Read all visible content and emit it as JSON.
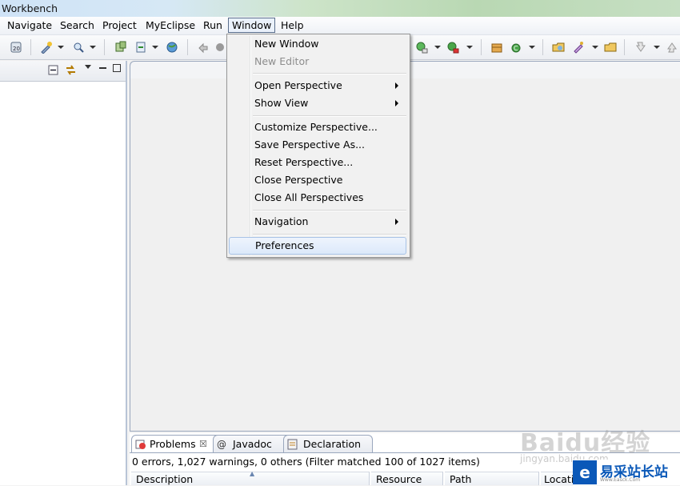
{
  "window": {
    "title": "Workbench"
  },
  "menubar": {
    "items": [
      {
        "label": "Navigate"
      },
      {
        "label": "Search"
      },
      {
        "label": "Project"
      },
      {
        "label": "MyEclipse"
      },
      {
        "label": "Run"
      },
      {
        "label": "Window"
      },
      {
        "label": "Help"
      }
    ],
    "open_menu": "Window"
  },
  "window_menu": {
    "items": [
      {
        "label": "New Window",
        "enabled": true
      },
      {
        "label": "New Editor",
        "enabled": false
      },
      {
        "label": "Open Perspective",
        "submenu": true
      },
      {
        "label": "Show View",
        "submenu": true
      },
      {
        "label": "Customize Perspective..."
      },
      {
        "label": "Save Perspective As..."
      },
      {
        "label": "Reset Perspective..."
      },
      {
        "label": "Close Perspective"
      },
      {
        "label": "Close All Perspectives"
      },
      {
        "label": "Navigation",
        "submenu": true
      },
      {
        "label": "Preferences",
        "highlighted": true
      }
    ]
  },
  "bottom_panel": {
    "tabs": [
      {
        "label": "Problems",
        "active": true,
        "icon": "problems-icon"
      },
      {
        "label": "Javadoc",
        "icon": "at-icon"
      },
      {
        "label": "Declaration",
        "icon": "declaration-icon"
      }
    ],
    "status": "0 errors, 1,027 warnings, 0 others (Filter matched 100 of 1027 items)",
    "columns": [
      "Description",
      "Resource",
      "Path",
      "Locati"
    ]
  },
  "watermark": {
    "baidu": "Baidu经验",
    "baidu_sub": "jingyan.baidu.com",
    "logo_mark": "e",
    "logo_name": "易采站长站",
    "logo_url": "Www.Easck.Com"
  },
  "colors": {
    "accent": "#0a58b8",
    "menu_highlight": "#dce9fa"
  }
}
